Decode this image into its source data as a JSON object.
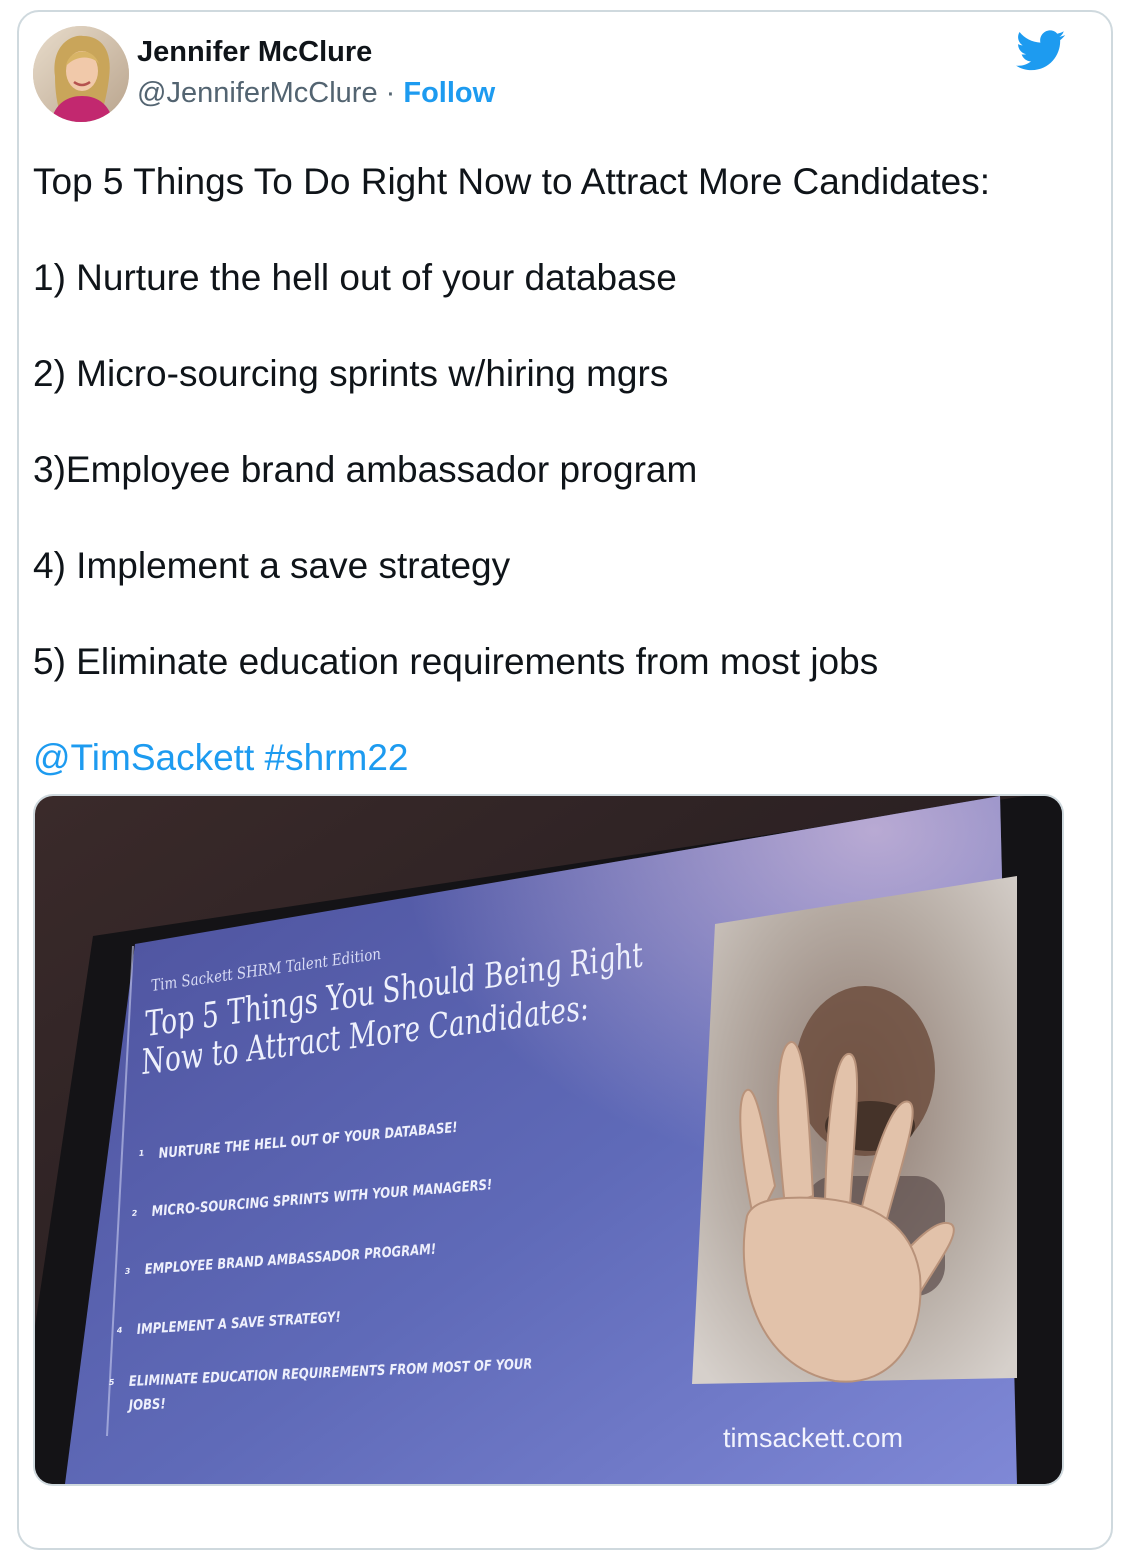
{
  "author": {
    "name": "Jennifer McClure",
    "handle": "@JenniferMcClure",
    "separator": "·",
    "follow_label": "Follow"
  },
  "icons": {
    "brand": "twitter-bird-icon",
    "brand_color": "#1d9bf0"
  },
  "tweet": {
    "headline": "Top 5 Things To Do Right Now to Attract More Candidates:",
    "items": [
      "1) Nurture the hell out of your database",
      "2) Micro-sourcing sprints w/hiring mgrs",
      "3)Employee brand ambassador program",
      "4) Implement a save strategy",
      "5) Eliminate education requirements from most jobs"
    ],
    "mention": "@TimSackett",
    "hashtag": "#shrm22"
  },
  "slide": {
    "edition": "Tim Sackett SHRM Talent Edition",
    "title_line1": "Top 5 Things You Should Being Right",
    "title_line2": "Now to Attract More Candidates:",
    "bullets": [
      {
        "num": "1",
        "text": "NURTURE THE HELL OUT OF YOUR DATABASE!"
      },
      {
        "num": "2",
        "text": "MICRO-SOURCING SPRINTS WITH YOUR MANAGERS!"
      },
      {
        "num": "3",
        "text": "EMPLOYEE BRAND AMBASSADOR PROGRAM!"
      },
      {
        "num": "4",
        "text": "IMPLEMENT A SAVE STRATEGY!"
      },
      {
        "num": "5",
        "text": "ELIMINATE EDUCATION REQUIREMENTS FROM MOST OF YOUR"
      }
    ],
    "bullet5_cont": "JOBS!",
    "footer": "timsackett.com"
  },
  "colors": {
    "link": "#1d9bf0",
    "text": "#0f1419",
    "muted": "#536471",
    "border": "#cfd9de"
  }
}
